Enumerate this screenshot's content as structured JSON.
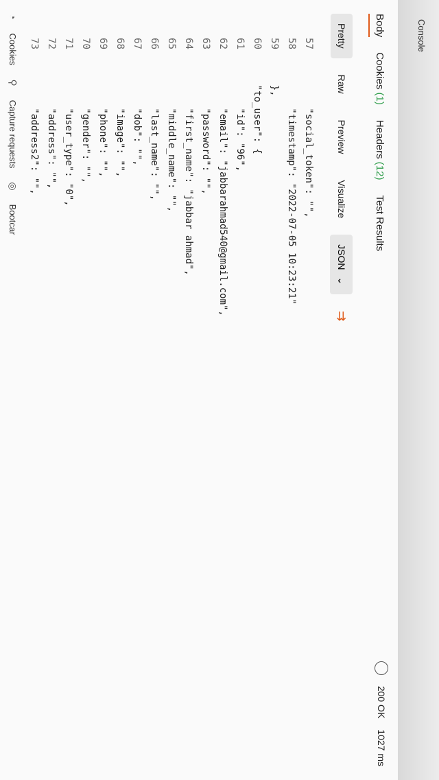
{
  "sidebar": {
    "console_label": "Console"
  },
  "tabs": [
    {
      "label": "Body"
    },
    {
      "label": "Cookies",
      "count": "(1)"
    },
    {
      "label": "Headers",
      "count": "(12)"
    },
    {
      "label": "Test Results"
    }
  ],
  "status": {
    "code": "200 OK",
    "time": "1027 ms"
  },
  "view": {
    "pretty": "Pretty",
    "raw": "Raw",
    "preview": "Preview",
    "visualize": "Visualize",
    "format": "JSON"
  },
  "code_lines": [
    {
      "n": "57",
      "t": "        \"social_token\": \"\","
    },
    {
      "n": "58",
      "t": "        \"timestamp\": \"2022-07-05 10:23:21\""
    },
    {
      "n": "59",
      "t": "    },"
    },
    {
      "n": "60",
      "t": "    \"to_user\": {"
    },
    {
      "n": "61",
      "t": "        \"id\": \"96\","
    },
    {
      "n": "62",
      "t": "        \"email\": \"jabbarahmad540@gmail.com\","
    },
    {
      "n": "63",
      "t": "        \"password\": \"\","
    },
    {
      "n": "64",
      "t": "        \"first_name\": \"jabbar ahmad\","
    },
    {
      "n": "65",
      "t": "        \"middle_name\": \"\","
    },
    {
      "n": "66",
      "t": "        \"last_name\": \"\","
    },
    {
      "n": "67",
      "t": "        \"dob\": \"\","
    },
    {
      "n": "68",
      "t": "        \"image\": \"\","
    },
    {
      "n": "69",
      "t": "        \"phone\": \"\","
    },
    {
      "n": "70",
      "t": "        \"gender\": \"\","
    },
    {
      "n": "71",
      "t": "        \"user_type\": \"0\","
    },
    {
      "n": "72",
      "t": "        \"address\": \"\","
    },
    {
      "n": "73",
      "t": "        \"address2\": \"\","
    }
  ],
  "footer": {
    "cookies": "Cookies",
    "capture": "Capture requests",
    "bootcamp": "Bootcar"
  }
}
